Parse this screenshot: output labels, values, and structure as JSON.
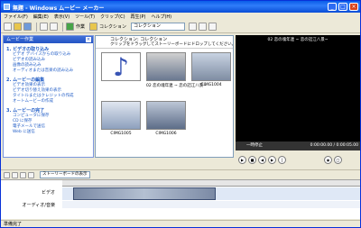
{
  "titlebar": {
    "title": "無題 - Windows ムービー メーカー",
    "minimize": "_",
    "maximize": "□",
    "close": "×"
  },
  "menu": [
    "ファイル(F)",
    "編集(E)",
    "表示(V)",
    "ツール(T)",
    "クリップ(C)",
    "再生(P)",
    "ヘルプ(H)"
  ],
  "toolbar": {
    "tasks_label": "作業",
    "collections_label": "コレクション",
    "collection_value": "コレクション"
  },
  "tasks_pane": {
    "header": "ムービー作業",
    "sections": [
      {
        "title": "1. ビデオの取り込み",
        "items": [
          "ビデオ デバイスからの取り込み",
          "ビデオの読み込み",
          "画像の読み込み",
          "オーディオまたは音楽の読み込み"
        ]
      },
      {
        "title": "2. ムービーの編集",
        "items": [
          "ビデオ効果の表示",
          "ビデオ切り替え効果の表示",
          "タイトルまたはクレジットの作成",
          "オートムービーの作成"
        ]
      },
      {
        "title": "3. ムービーの完了",
        "items": [
          "コンピュータに保存",
          "CD に保存",
          "電子メールで送信",
          "Web に送信"
        ]
      }
    ]
  },
  "content": {
    "title": "コレクション: コレクション",
    "hint": "クリップをドラッグしてストーリーボードにドロップしてください。",
    "clips": [
      "",
      "02 恋の魂年連 ~ 恋の詰江八景~",
      "CIMG1004",
      "CIMG1005",
      "CIMG1006"
    ]
  },
  "preview": {
    "title": "02 恋の魂年連 ~ 恋の詰江八景~",
    "status": "一時停止",
    "time": "0:00:00.00 / 0:00:05.00"
  },
  "timeline": {
    "storyboard_label": "ストーリーボードの表示",
    "video_label": "ビデオ",
    "audio_label": "オーディオ/音楽"
  },
  "statusbar": {
    "text": "準備完了"
  }
}
